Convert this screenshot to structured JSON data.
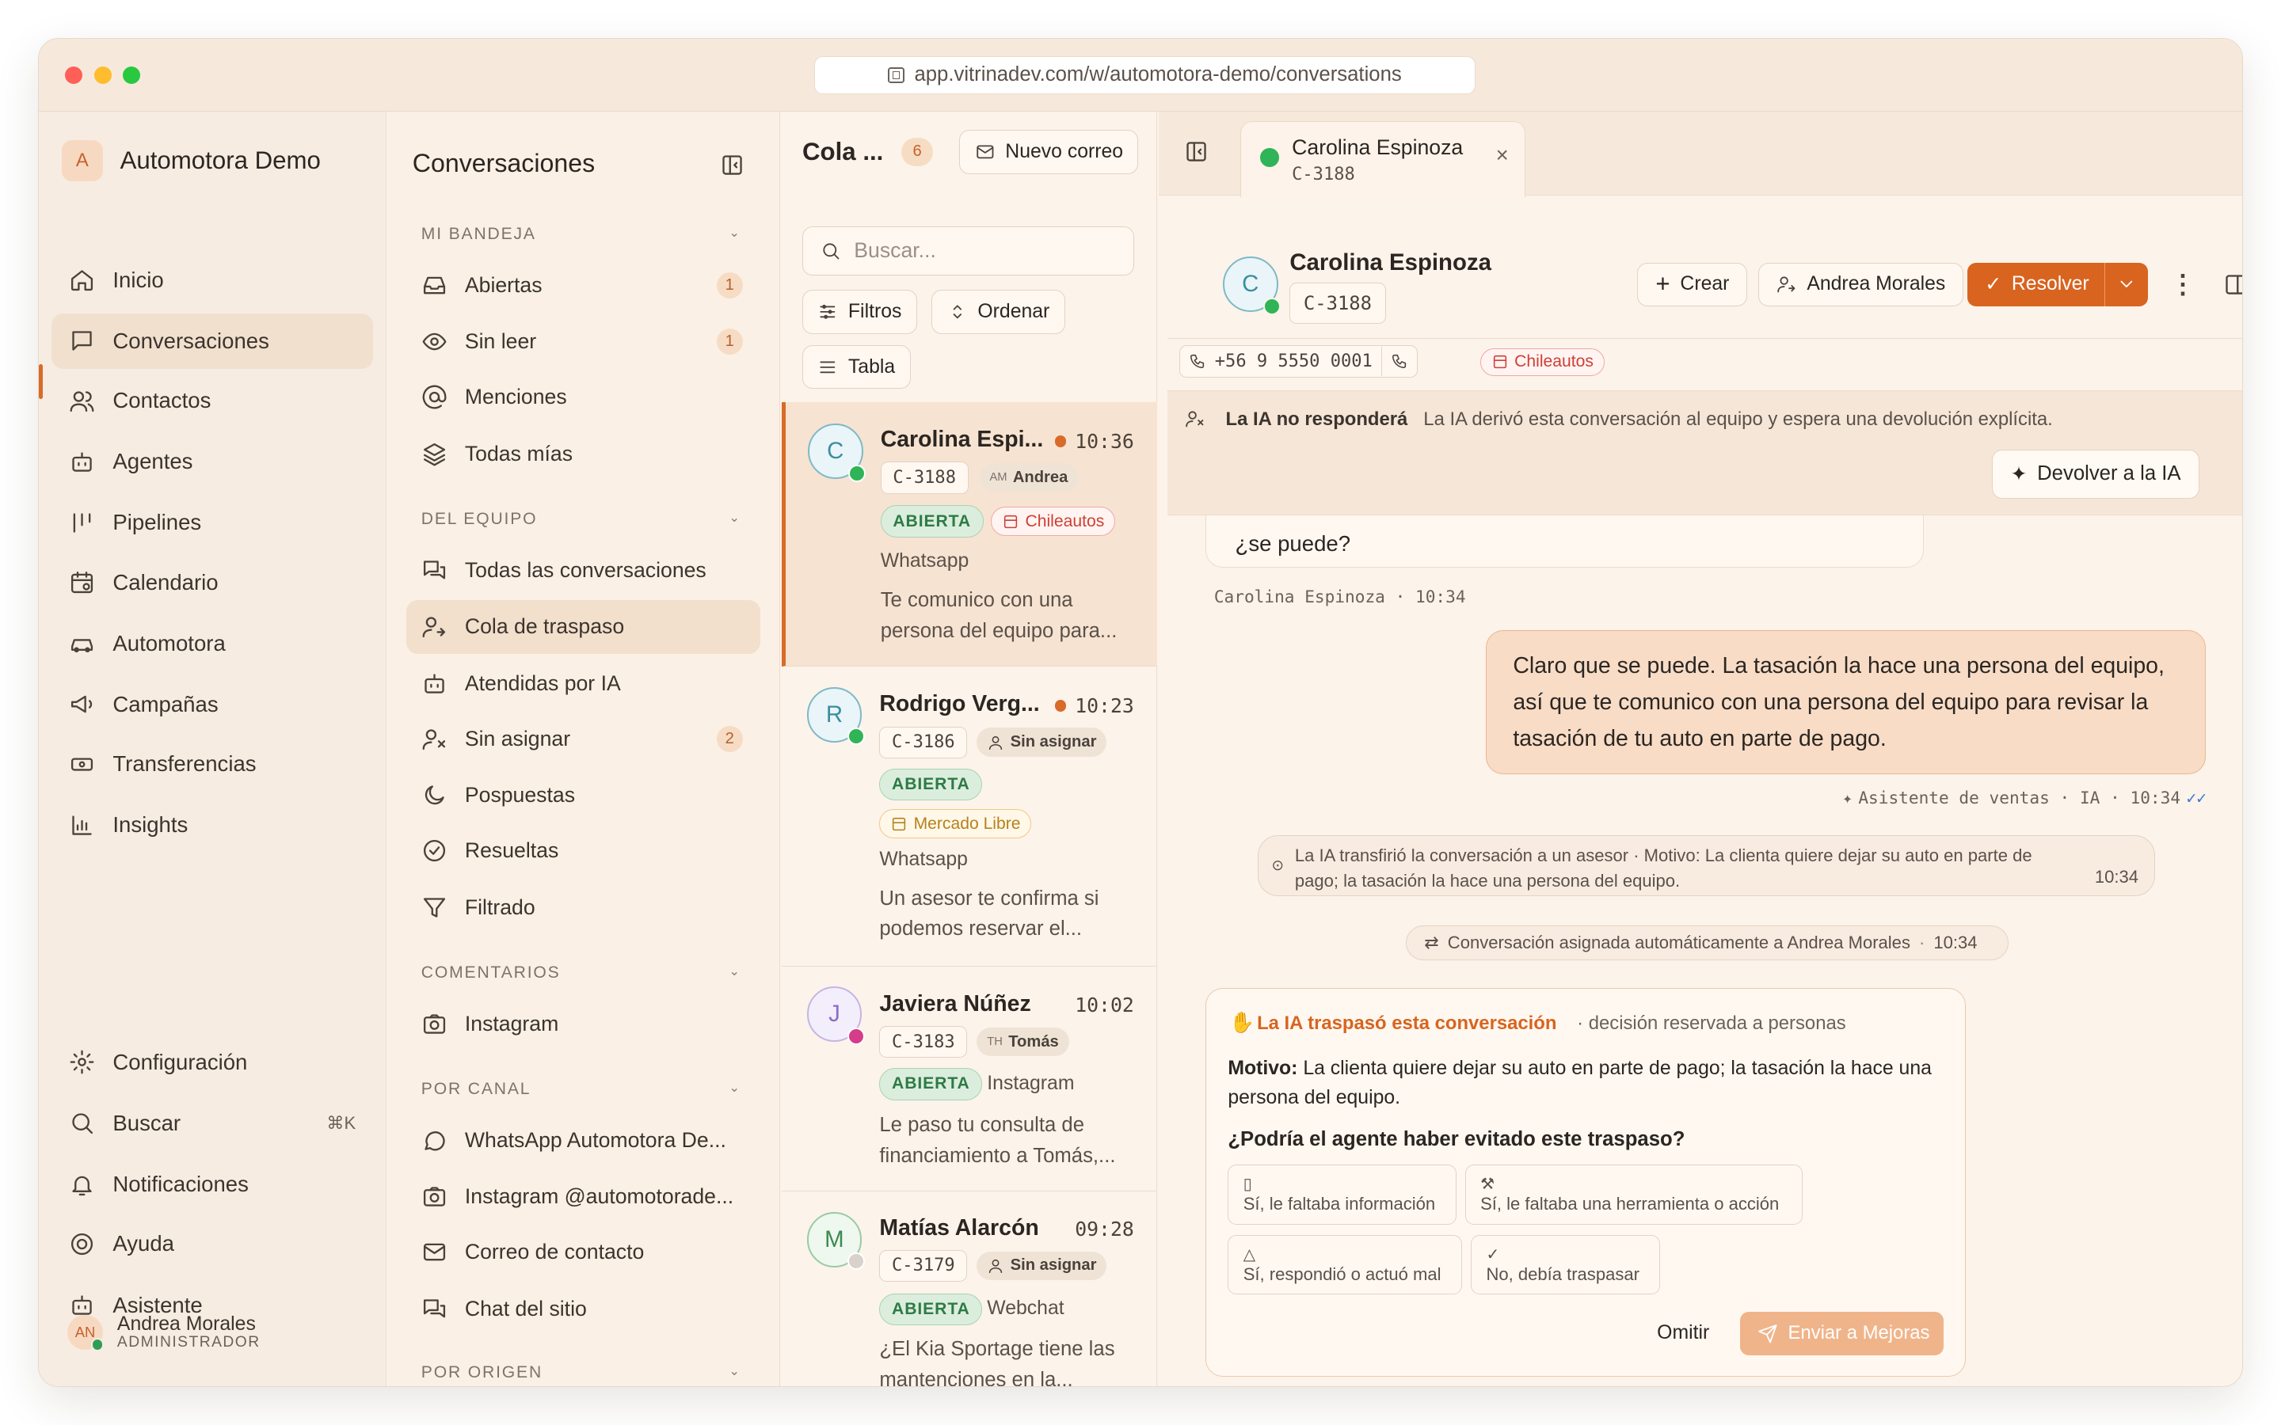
{
  "browser": {
    "url": "app.vitrinadev.com/w/automotora-demo/conversations"
  },
  "colors": {
    "accent": "#d8641f",
    "open_badge": "#2f7a46",
    "whatsapp": "#2fb457",
    "instagram": "#d63c8a",
    "unread": "#d86b2a"
  },
  "sidebar": {
    "org_initial": "A",
    "org_name": "Automotora Demo",
    "items": [
      {
        "label": "Inicio",
        "icon": "home-icon"
      },
      {
        "label": "Conversaciones",
        "icon": "chat-icon"
      },
      {
        "label": "Contactos",
        "icon": "users-icon"
      },
      {
        "label": "Agentes",
        "icon": "bot-icon"
      },
      {
        "label": "Pipelines",
        "icon": "pipeline-icon"
      },
      {
        "label": "Calendario",
        "icon": "calendar-icon"
      },
      {
        "label": "Automotora",
        "icon": "car-icon"
      },
      {
        "label": "Campañas",
        "icon": "megaphone-icon"
      },
      {
        "label": "Transferencias",
        "icon": "transfer-icon"
      },
      {
        "label": "Insights",
        "icon": "chart-icon"
      }
    ],
    "bottom": [
      {
        "label": "Configuración",
        "icon": "gear-icon"
      },
      {
        "label": "Buscar",
        "icon": "search-icon",
        "shortcut": "⌘K"
      },
      {
        "label": "Notificaciones",
        "icon": "bell-icon"
      },
      {
        "label": "Ayuda",
        "icon": "help-icon"
      },
      {
        "label": "Asistente",
        "icon": "bot-icon"
      }
    ],
    "user": {
      "initials": "AN",
      "name": "Andrea Morales",
      "role": "ADMINISTRADOR"
    }
  },
  "conv_panel": {
    "title": "Conversaciones",
    "sections": {
      "mine": "MI BANDEJA",
      "team": "DEL EQUIPO",
      "comments": "COMENTARIOS",
      "channel": "POR CANAL",
      "origin": "POR ORIGEN"
    },
    "mine": [
      {
        "label": "Abiertas",
        "count": "1"
      },
      {
        "label": "Sin leer",
        "count": "1"
      },
      {
        "label": "Menciones"
      },
      {
        "label": "Todas mías"
      }
    ],
    "team": [
      {
        "label": "Todas las conversaciones"
      },
      {
        "label": "Cola de traspaso"
      },
      {
        "label": "Atendidas por IA"
      },
      {
        "label": "Sin asignar",
        "count": "2"
      },
      {
        "label": "Pospuestas"
      },
      {
        "label": "Resueltas"
      },
      {
        "label": "Filtrado"
      }
    ],
    "comments": [
      {
        "label": "Instagram"
      }
    ],
    "channel": [
      {
        "label": "WhatsApp Automotora De..."
      },
      {
        "label": "Instagram @automotorade..."
      },
      {
        "label": "Correo de contacto"
      },
      {
        "label": "Chat del sitio"
      }
    ]
  },
  "queue": {
    "title": "Cola ...",
    "count": "6",
    "new_mail": "Nuevo correo",
    "search_placeholder": "Buscar...",
    "filters": "Filtros",
    "sort": "Ordenar",
    "table": "Tabla",
    "items": [
      {
        "initial": "C",
        "name": "Carolina Espi...",
        "time": "10:36",
        "code": "C-3188",
        "agent_initials": "AM",
        "agent": "Andrea",
        "status": "ABIERTA",
        "source": "Chileautos",
        "channel": "Whatsapp",
        "preview": "Te comunico con una persona del equipo para..."
      },
      {
        "initial": "R",
        "name": "Rodrigo Verg...",
        "time": "10:23",
        "code": "C-3186",
        "agent": "Sin asignar",
        "status": "ABIERTA",
        "source": "Mercado Libre",
        "channel": "Whatsapp",
        "preview": "Un asesor te confirma si podemos reservar el..."
      },
      {
        "initial": "J",
        "name": "Javiera Núñez",
        "time": "10:02",
        "code": "C-3183",
        "agent_initials": "TH",
        "agent": "Tomás",
        "status": "ABIERTA",
        "channel": "Instagram",
        "preview": "Le paso tu consulta de financiamiento a Tomás,..."
      },
      {
        "initial": "M",
        "name": "Matías Alarcón",
        "time": "09:28",
        "code": "C-3179",
        "agent": "Sin asignar",
        "status": "ABIERTA",
        "channel": "Webchat",
        "preview": "¿El Kia Sportage tiene las mantenciones en la..."
      }
    ]
  },
  "chat": {
    "tab": {
      "name": "Carolina Espinoza",
      "code": "C-3188"
    },
    "contact": {
      "initial": "C",
      "name": "Carolina Espinoza",
      "code": "C-3188",
      "phone": "+56 9 5550 0001",
      "source": "Chileautos"
    },
    "actions": {
      "create": "Crear",
      "assignee": "Andrea Morales",
      "resolve": "Resolver"
    },
    "banner": {
      "title": "La IA no responderá",
      "text": "La IA derivó esta conversación al equipo y espera una devolución explícita.",
      "button": "Devolver a la IA"
    },
    "incoming": {
      "text": "¿se puede?",
      "meta": "Carolina Espinoza · 10:34"
    },
    "outgoing": {
      "text": "Claro que se puede. La tasación la hace una persona del equipo, así que te comunico con una persona del equipo para revisar la tasación de tu auto en parte de pago.",
      "meta": "Asistente de ventas · IA · 10:34"
    },
    "transfer": {
      "text": "La IA transfirió la conversación a un asesor · Motivo: La clienta quiere dejar su auto en parte de pago; la tasación la hace una persona del equipo.",
      "time": "10:34"
    },
    "assigned": {
      "text": "Conversación asignada automáticamente a Andrea Morales",
      "time": "10:34"
    },
    "handoff": {
      "title": "La IA traspasó esta conversación",
      "subtitle": "· decisión reservada a personas",
      "reason_label": "Motivo:",
      "reason": "La clienta quiere dejar su auto en parte de pago; la tasación la hace una persona del equipo.",
      "question": "¿Podría el agente haber evitado este traspaso?",
      "options": [
        "Sí, le faltaba información",
        "Sí, le faltaba una herramienta o acción",
        "Sí, respondió o actuó mal",
        "No, debía traspasar"
      ],
      "skip": "Omitir",
      "send": "Enviar a Mejoras"
    }
  }
}
